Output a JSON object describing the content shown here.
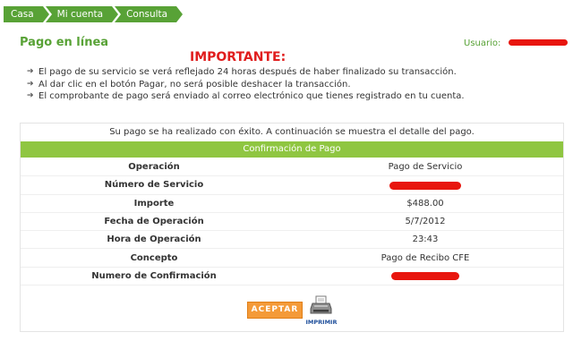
{
  "breadcrumb": [
    {
      "label": "Casa"
    },
    {
      "label": "Mi cuenta"
    },
    {
      "label": "Consulta"
    }
  ],
  "page_title": "Pago en línea",
  "user_label": "Usuario:",
  "important_title": "IMPORTANTE:",
  "notes": [
    "El pago de su servicio se verá reflejado 24 horas después de haber finalizado su transacción.",
    "Al dar clic en el botón Pagar, no será posible deshacer la transacción.",
    "El comprobante de pago será enviado al correo electrónico que tienes registrado en tu cuenta."
  ],
  "success_message": "Su pago se ha realizado con éxito. A continuación se muestra el detalle del pago.",
  "confirmation_header": "Confirmación de Pago",
  "details": [
    {
      "label": "Operación",
      "value": "Pago de Servicio"
    },
    {
      "label": "Número de Servicio",
      "value": ""
    },
    {
      "label": "Importe",
      "value": "$488.00"
    },
    {
      "label": "Fecha de Operación",
      "value": "5/7/2012"
    },
    {
      "label": "Hora de Operación",
      "value": "23:43"
    },
    {
      "label": "Concepto",
      "value": "Pago de Recibo CFE"
    },
    {
      "label": "Numero de Confirmación",
      "value": ""
    }
  ],
  "buttons": {
    "accept": "ACEPTAR",
    "print": "IMPRIMIR"
  },
  "colors": {
    "brand_green": "#58a236",
    "header_green": "#8fc641",
    "important_red": "#e01d1d",
    "accept_orange": "#f49a38",
    "redaction_red": "#e8160e"
  },
  "icons": {
    "note_bullet": "arrow-right-icon",
    "print": "printer-icon"
  }
}
